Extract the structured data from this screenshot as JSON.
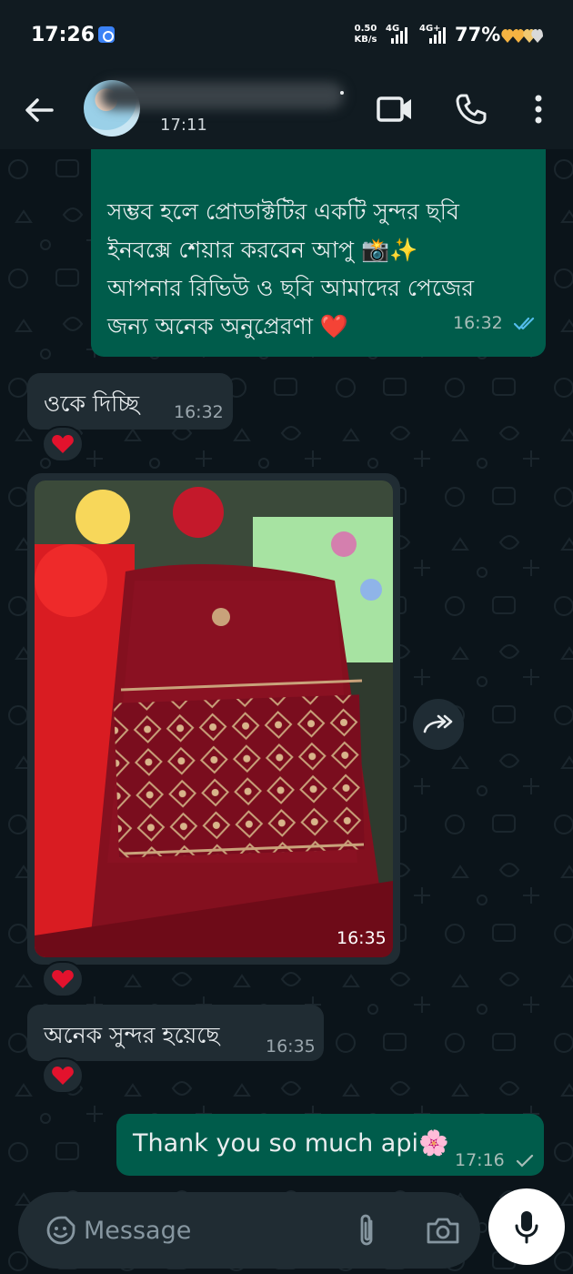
{
  "status_bar": {
    "time": "17:26",
    "net_speed_value": "0.50",
    "net_speed_unit": "KB/s",
    "signal1_label": "4G",
    "signal2_label": "4G+",
    "battery": "77%"
  },
  "header": {
    "last_seen": "17:11"
  },
  "messages": [
    {
      "direction": "out",
      "lines": [
        "সম্ভব হলে প্রোডাক্টটির একটি সুন্দর ছবি",
        "ইনবক্সে শেয়ার করবেন আপু 📸✨",
        "আপনার রিভিউ ও ছবি আমাদের পেজের",
        "জন্য অনেক অনুপ্রেরণা ❤️"
      ],
      "time": "16:32",
      "status": "read"
    },
    {
      "direction": "in",
      "text": "ওকে দিচ্ছি",
      "time": "16:32",
      "reaction": "❤️"
    },
    {
      "direction": "in",
      "type": "image",
      "time": "16:35",
      "reaction": "❤️"
    },
    {
      "direction": "in",
      "text": "অনেক সুন্দর হয়েছে",
      "time": "16:35",
      "reaction": "❤️"
    },
    {
      "direction": "out",
      "text": "Thank you so much api🌸",
      "time": "17:16",
      "status": "sent"
    }
  ],
  "composer": {
    "placeholder": "Message"
  },
  "colors": {
    "background": "#0b141a",
    "outgoing_bubble": "#005c4b",
    "incoming_bubble": "#202c33",
    "read_tick": "#53bdeb",
    "header": "#111b21"
  },
  "icons": [
    "back-arrow-icon",
    "video-call-icon",
    "phone-icon",
    "more-options-icon",
    "forward-icon",
    "emoji-icon",
    "attach-icon",
    "camera-icon",
    "mic-icon",
    "heart-reaction-icon"
  ]
}
